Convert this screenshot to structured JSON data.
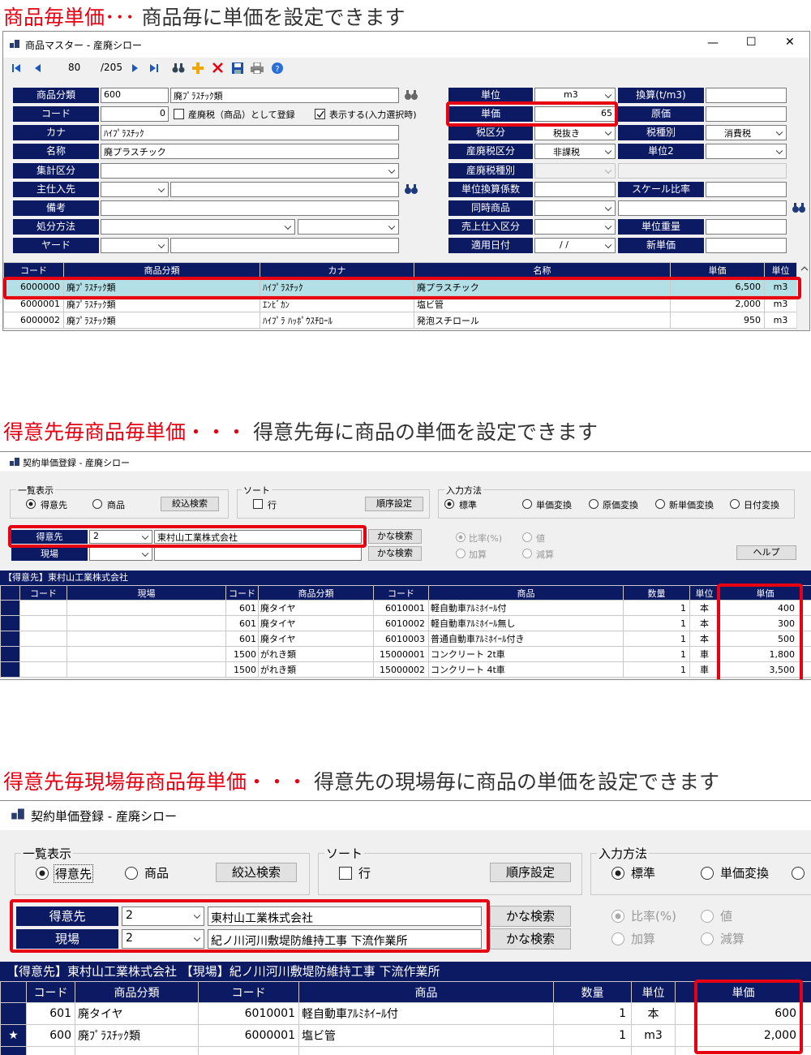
{
  "colors": {
    "accent_red": "#e60012",
    "header_navy": "#0c1a63",
    "row_highlight": "#b3e0e6"
  },
  "section1": {
    "heading_red": "商品毎単価･･･",
    "heading_text": "商品毎に単価を設定できます",
    "window_title": "商品マスター - 産廃シロー",
    "window_controls": {
      "minimize": "—",
      "maximize": "☐",
      "close": "✕"
    },
    "nav": {
      "record": "80",
      "total": "/205"
    },
    "form": {
      "product_category": {
        "label": "商品分類",
        "code": "600",
        "name": "廃ﾌﾟﾗｽﾁｯｸ類"
      },
      "code": {
        "label": "コード",
        "value": "0",
        "chk_tax_label": "産廃税（商品）として登録",
        "chk_display_label": "表示する(入力選択時)"
      },
      "kana": {
        "label": "カナ",
        "value": "ﾊｲﾌﾟﾗｽﾁｯｸ"
      },
      "name": {
        "label": "名称",
        "value": "廃プラスチック"
      },
      "aggregate": {
        "label": "集計区分"
      },
      "supplier": {
        "label": "主仕入先"
      },
      "note": {
        "label": "備考"
      },
      "disposal": {
        "label": "処分方法"
      },
      "yard": {
        "label": "ヤード"
      },
      "unit": {
        "label": "単位",
        "value": "m3"
      },
      "conversion": {
        "label": "換算(t/m3)"
      },
      "unit_price": {
        "label": "単価",
        "value": "65"
      },
      "cost": {
        "label": "原価"
      },
      "tax_class": {
        "label": "税区分",
        "value": "税抜き"
      },
      "tax_type": {
        "label": "税種別",
        "value": "消費税"
      },
      "ind_tax_class": {
        "label": "産廃税区分",
        "value": "非課税"
      },
      "unit2": {
        "label": "単位2"
      },
      "ind_tax_type": {
        "label": "産廃税種別"
      },
      "unit_conv_coef": {
        "label": "単位換算係数"
      },
      "scale_ratio": {
        "label": "スケール比率"
      },
      "simultaneous": {
        "label": "同時商品"
      },
      "sales_purchase": {
        "label": "売上仕入区分"
      },
      "unit_weight": {
        "label": "単位重量"
      },
      "apply_date": {
        "label": "適用日付",
        "value": "/ /"
      },
      "new_unit_price": {
        "label": "新単価"
      }
    },
    "table": {
      "headers": [
        "コード",
        "商品分類",
        "カナ",
        "名称",
        "単価",
        "単位"
      ],
      "rows": [
        [
          "6000000",
          "廃ﾌﾟﾗｽﾁｯｸ類",
          "ﾊｲﾌﾟﾗｽﾁｯｸ",
          "廃プラスチック",
          "6,500",
          "m3"
        ],
        [
          "6000001",
          "廃ﾌﾟﾗｽﾁｯｸ類",
          "ｴﾝﾋﾞｶﾝ",
          "塩ビ管",
          "2,000",
          "m3"
        ],
        [
          "6000002",
          "廃ﾌﾟﾗｽﾁｯｸ類",
          "ﾊｲﾌﾟﾗ ﾊｯﾎﾟｳｽﾁﾛｰﾙ",
          "発泡スチロール",
          "950",
          "m3"
        ]
      ]
    }
  },
  "section2": {
    "heading_red": "得意先毎商品毎単価・・・",
    "heading_text": "得意先毎に商品の単価を設定できます",
    "window_title": "契約単価登録 - 産廃シロー",
    "list_group": {
      "title": "一覧表示",
      "opt1": "得意先",
      "opt2": "商品",
      "filter_button": "絞込検索"
    },
    "sort_group": {
      "title": "ソート",
      "chk": "行",
      "order_button": "順序設定"
    },
    "input_group": {
      "title": "入力方法",
      "opt1": "標準",
      "opt2": "単価変換",
      "opt3": "原価変換",
      "opt4": "新単価変換",
      "opt5": "日付変換"
    },
    "customer": {
      "label": "得意先",
      "code": "2",
      "name": "東村山工業株式会社"
    },
    "site": {
      "label": "現場",
      "code": "",
      "name": ""
    },
    "kana_search": "かな検索",
    "ratio_opts": {
      "o1": "比率(%)",
      "o2": "値",
      "o3": "加算",
      "o4": "減算"
    },
    "help_button": "ヘルプ",
    "grid_title": "【得意先】東村山工業株式会社",
    "table": {
      "headers": [
        "",
        "コード",
        "現場",
        "コード",
        "商品分類",
        "コード",
        "商品",
        "数量",
        "単位",
        "単価"
      ],
      "rows": [
        [
          "",
          "",
          "",
          "601",
          "廃タイヤ",
          "6010001",
          "軽自動車ｱﾙﾐﾎｲｰﾙ付",
          "1",
          "本",
          "400"
        ],
        [
          "",
          "",
          "",
          "601",
          "廃タイヤ",
          "6010002",
          "軽自動車ｱﾙﾐﾎｲｰﾙ無し",
          "1",
          "本",
          "300"
        ],
        [
          "",
          "",
          "",
          "601",
          "廃タイヤ",
          "6010003",
          "普通自動車ｱﾙﾐﾎｲｰﾙ付き",
          "1",
          "本",
          "500"
        ],
        [
          "",
          "",
          "",
          "1500",
          "がれき類",
          "15000001",
          "コンクリート 2t車",
          "1",
          "車",
          "1,800"
        ],
        [
          "",
          "",
          "",
          "1500",
          "がれき類",
          "15000002",
          "コンクリート 4t車",
          "1",
          "車",
          "3,500"
        ]
      ]
    }
  },
  "section3": {
    "heading_red": "得意先毎現場毎商品毎単価・・・",
    "heading_text": "得意先の現場毎に商品の単価を設定できます",
    "window_title": "契約単価登録 - 産廃シロー",
    "list_group": {
      "title": "一覧表示",
      "opt1": "得意先",
      "opt2": "商品",
      "filter_button": "絞込検索"
    },
    "sort_group": {
      "title": "ソート",
      "chk": "行",
      "order_button": "順序設定"
    },
    "input_group": {
      "title": "入力方法",
      "opt1": "標準",
      "opt2": "単価変換"
    },
    "customer": {
      "label": "得意先",
      "code": "2",
      "name": "東村山工業株式会社"
    },
    "site": {
      "label": "現場",
      "code": "2",
      "name": "紀ノ川河川敷堤防維持工事 下流作業所"
    },
    "kana_search": "かな検索",
    "ratio_opts": {
      "o1": "比率(%)",
      "o2": "値",
      "o3": "加算",
      "o4": "減算"
    },
    "grid_title": "【得意先】東村山工業株式会社 【現場】紀ノ川河川敷堤防維持工事 下流作業所",
    "table": {
      "headers": [
        "",
        "コード",
        "商品分類",
        "コード",
        "商品",
        "数量",
        "単位",
        "単価"
      ],
      "rows": [
        [
          "",
          "601",
          "廃タイヤ",
          "6010001",
          "軽自動車ｱﾙﾐﾎｲｰﾙ付",
          "1",
          "本",
          "600"
        ],
        [
          "★",
          "600",
          "廃ﾌﾟﾗｽﾁｯｸ類",
          "6000001",
          "塩ビ管",
          "1",
          "m3",
          "2,000"
        ]
      ]
    }
  }
}
